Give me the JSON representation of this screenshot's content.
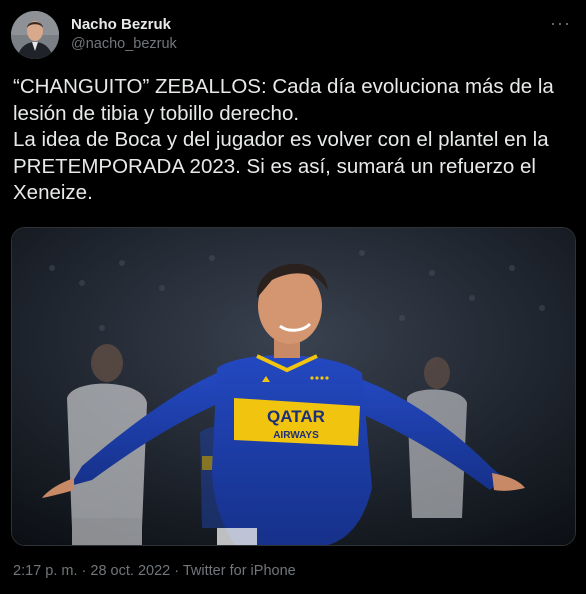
{
  "author": {
    "display_name": "Nacho Bezruk",
    "handle": "@nacho_bezruk"
  },
  "more_icon": "more-horizontal-icon",
  "tweet": {
    "text": "“CHANGUITO” ZEBALLOS: Cada día evoluciona más de la lesión de tibia y tobillo derecho.\nLa idea de Boca y del jugador es volver con el plantel en la PRETEMPORADA 2023. Si es así, sumará un refuerzo el Xeneize."
  },
  "photo": {
    "sponsor_top": "QATAR",
    "sponsor_bottom": "AIRWAYS",
    "kit_colors": {
      "blue": "#1c3faa",
      "yellow": "#f1c40f"
    }
  },
  "meta": {
    "time": "2:17 p. m.",
    "date": "28 oct. 2022",
    "source": "Twitter for iPhone"
  }
}
